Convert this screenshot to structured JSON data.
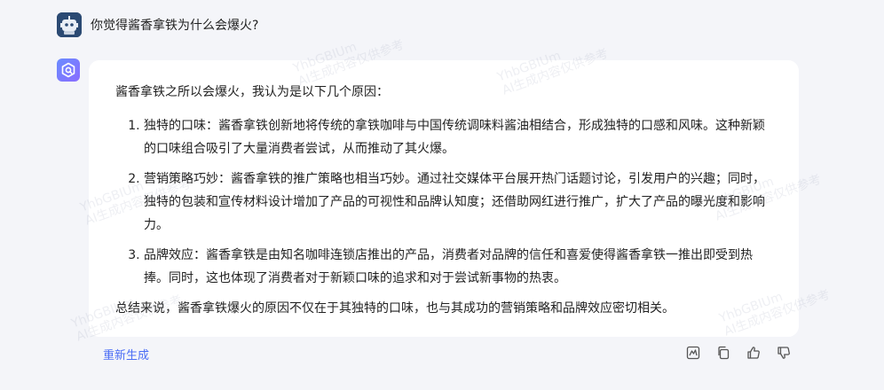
{
  "conversation": {
    "user": {
      "question": "你觉得酱香拿铁为什么会爆火?"
    },
    "answer": {
      "intro": "酱香拿铁之所以会爆火，我认为是以下几个原因：",
      "points": [
        {
          "text": "独特的口味：酱香拿铁创新地将传统的拿铁咖啡与中国传统调味料酱油相结合，形成独特的口感和风味。这种新颖的口味组合吸引了大量消费者尝试，从而推动了其火爆。"
        },
        {
          "text": "营销策略巧妙：酱香拿铁的推广策略也相当巧妙。通过社交媒体平台展开热门话题讨论，引发用户的兴趣；同时，独特的包装和宣传材料设计增加了产品的可视性和品牌认知度；还借助网红进行推广，扩大了产品的曝光度和影响力。"
        },
        {
          "text": "品牌效应：酱香拿铁是由知名咖啡连锁店推出的产品，消费者对品牌的信任和喜爱使得酱香拿铁一推出即受到热捧。同时，这也体现了消费者对于新颖口味的追求和对于尝试新事物的热衷。"
        }
      ],
      "summary": "总结来说，酱香拿铁爆火的原因不仅在于其独特的口味，也与其成功的营销策略和品牌效应密切相关。"
    },
    "watermark": {
      "line1": "YhbGBIUm",
      "line2": "AI生成内容仅供参考"
    }
  },
  "actions": {
    "regenerate_label": "重新生成",
    "icons": [
      "chart-icon",
      "copy-icon",
      "thumbs-up-icon",
      "thumbs-down-icon"
    ]
  },
  "colors": {
    "accent": "#4c6ef5",
    "background": "#f4f5f9",
    "card": "#ffffff"
  }
}
